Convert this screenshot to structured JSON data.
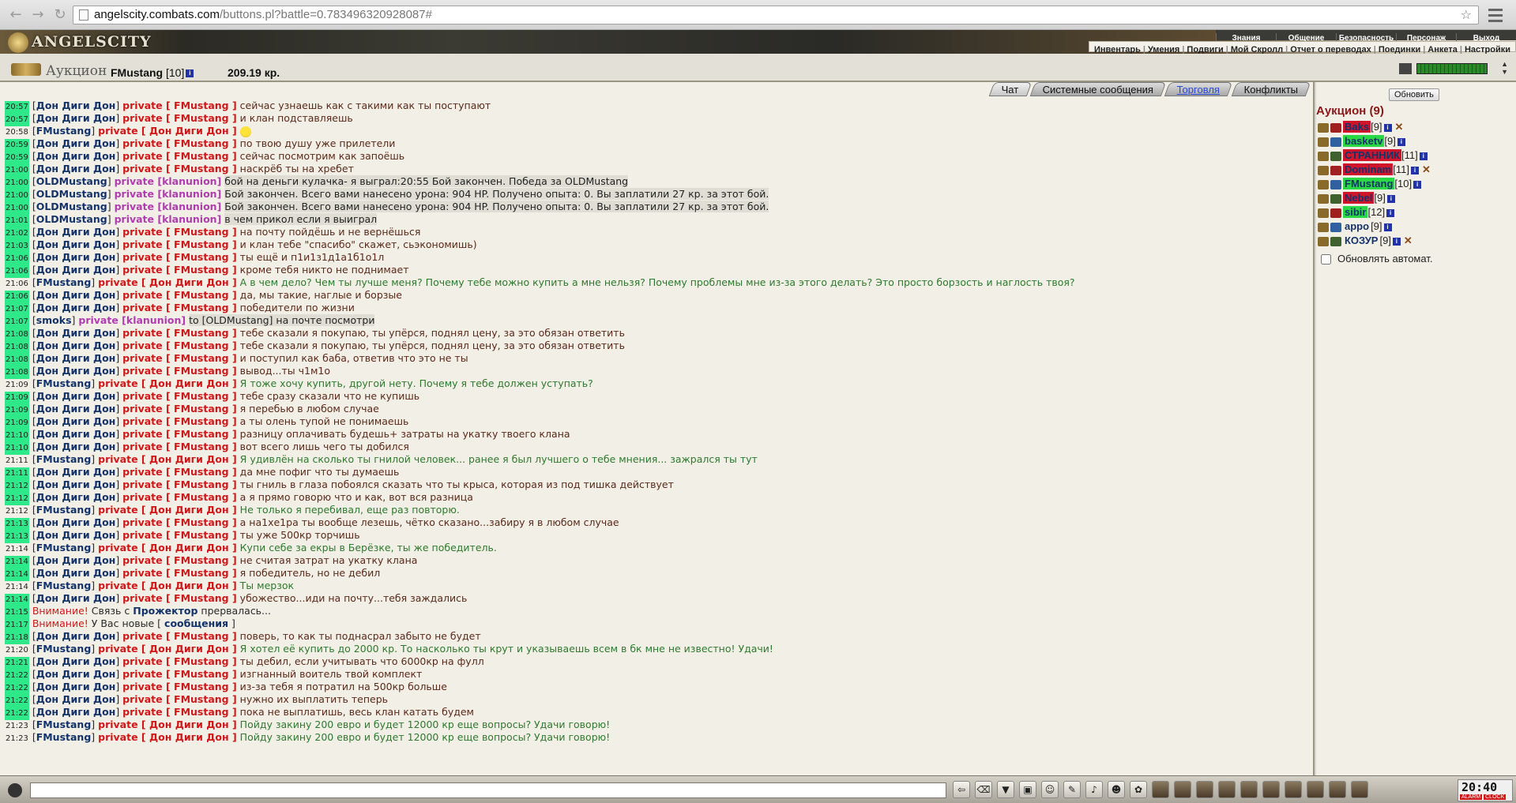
{
  "browser": {
    "url_host": "angelscity.combats.com",
    "url_rest": "/buttons.pl?battle=0.783496320928087#"
  },
  "game": {
    "logo": "ANGELSCITY",
    "top_menu": [
      "Знания",
      "Общение",
      "Безопасность",
      "Персонаж",
      "Выход"
    ],
    "sub_menu": [
      "Инвентарь",
      "Умения",
      "Подвиги",
      "Мой Скролл",
      "Отчет о переводах",
      "Поединки",
      "Анкета",
      "Настройки"
    ]
  },
  "location": {
    "name": "Аукцион",
    "user": "FMustang",
    "level": "[10]",
    "money": "209.19 кр."
  },
  "chat": {
    "tabs": [
      {
        "label": "Чат",
        "style": "active"
      },
      {
        "label": "Системные сообщения",
        "style": ""
      },
      {
        "label": "Торговля",
        "style": "link"
      },
      {
        "label": "Конфликты",
        "style": ""
      }
    ],
    "lines": [
      {
        "time": "20:57",
        "hl": true,
        "from": "Дон Диги Дон",
        "kind": "prv",
        "to": "FMustang",
        "mk": "in",
        "text": "сейчас узнаешь как с такими как ты поступают"
      },
      {
        "time": "20:57",
        "hl": true,
        "from": "Дон Диги Дон",
        "kind": "prv",
        "to": "FMustang",
        "mk": "in",
        "text": "и клан подставляешь"
      },
      {
        "time": "20:58",
        "hl": false,
        "from": "FMustang",
        "kind": "prv",
        "to": "Дон Диги Дон",
        "mk": "out",
        "text": "",
        "smile": true
      },
      {
        "time": "20:59",
        "hl": true,
        "from": "Дон Диги Дон",
        "kind": "prv",
        "to": "FMustang",
        "mk": "in",
        "text": "по твою душу уже прилетели"
      },
      {
        "time": "20:59",
        "hl": true,
        "from": "Дон Диги Дон",
        "kind": "prv",
        "to": "FMustang",
        "mk": "in",
        "text": "сейчас посмотрим как запоёшь"
      },
      {
        "time": "21:00",
        "hl": true,
        "from": "Дон Диги Дон",
        "kind": "prv",
        "to": "FMustang",
        "mk": "in",
        "text": "наскрёб ты на хребет"
      },
      {
        "time": "21:00",
        "hl": true,
        "from": "OLDMustang",
        "kind": "clan",
        "to": "klanunion",
        "mk": "sys",
        "text": "бой на деньги кулачка- я выграл:20:55 Бой закончен. Победа за OLDMustang"
      },
      {
        "time": "21:00",
        "hl": true,
        "from": "OLDMustang",
        "kind": "clan",
        "to": "klanunion",
        "mk": "sys",
        "text": "Бой закончен. Всего вами нанесено урона: 904 HP. Получено опыта: 0. Вы заплатили 27 кр. за этот бой."
      },
      {
        "time": "21:00",
        "hl": true,
        "from": "OLDMustang",
        "kind": "clan",
        "to": "klanunion",
        "mk": "sys",
        "text": "Бой закончен. Всего вами нанесено урона: 904 HP. Получено опыта: 0. Вы заплатили 27 кр. за этот бой."
      },
      {
        "time": "21:01",
        "hl": true,
        "from": "OLDMustang",
        "kind": "clan",
        "to": "klanunion",
        "mk": "sys",
        "text": "в чем прикол если я выиграл"
      },
      {
        "time": "21:02",
        "hl": true,
        "from": "Дон Диги Дон",
        "kind": "prv",
        "to": "FMustang",
        "mk": "in",
        "text": "на почту пойдёшь и не вернёшься"
      },
      {
        "time": "21:03",
        "hl": true,
        "from": "Дон Диги Дон",
        "kind": "prv",
        "to": "FMustang",
        "mk": "in",
        "text": "и клан тебе \"спасибо\" скажет, сьэкономишь)"
      },
      {
        "time": "21:06",
        "hl": true,
        "from": "Дон Диги Дон",
        "kind": "prv",
        "to": "FMustang",
        "mk": "in",
        "text": "ты ещё и п1и1з1д1а1б1о1л"
      },
      {
        "time": "21:06",
        "hl": true,
        "from": "Дон Диги Дон",
        "kind": "prv",
        "to": "FMustang",
        "mk": "in",
        "text": "кроме тебя никто не поднимает"
      },
      {
        "time": "21:06",
        "hl": false,
        "from": "FMustang",
        "kind": "prv",
        "to": "Дон Диги Дон",
        "mk": "out",
        "text": "А в чем дело? Чем ты лучше меня? Почему тебе можно купить а мне нельзя? Почему проблемы мне из-за этого делать? Это просто борзость и наглость твоя?"
      },
      {
        "time": "21:06",
        "hl": true,
        "from": "Дон Диги Дон",
        "kind": "prv",
        "to": "FMustang",
        "mk": "in",
        "text": "да, мы такие, наглые и борзые"
      },
      {
        "time": "21:07",
        "hl": true,
        "from": "Дон Диги Дон",
        "kind": "prv",
        "to": "FMustang",
        "mk": "in",
        "text": "победители по жизни"
      },
      {
        "time": "21:07",
        "hl": true,
        "from": "smoks",
        "kind": "clan",
        "to": "klanunion",
        "mk": "sys",
        "text": "to [OLDMustang] на почте посмотри"
      },
      {
        "time": "21:08",
        "hl": true,
        "from": "Дон Диги Дон",
        "kind": "prv",
        "to": "FMustang",
        "mk": "in",
        "text": "тебе сказали я покупаю, ты упёрся, поднял цену, за это обязан ответить"
      },
      {
        "time": "21:08",
        "hl": true,
        "from": "Дон Диги Дон",
        "kind": "prv",
        "to": "FMustang",
        "mk": "in",
        "text": "тебе сказали я покупаю, ты упёрся, поднял цену, за это обязан ответить"
      },
      {
        "time": "21:08",
        "hl": true,
        "from": "Дон Диги Дон",
        "kind": "prv",
        "to": "FMustang",
        "mk": "in",
        "text": "и поступил как баба, ответив что это не ты"
      },
      {
        "time": "21:08",
        "hl": true,
        "from": "Дон Диги Дон",
        "kind": "prv",
        "to": "FMustang",
        "mk": "in",
        "text": "вывод...ты ч1м1о"
      },
      {
        "time": "21:09",
        "hl": false,
        "from": "FMustang",
        "kind": "prv",
        "to": "Дон Диги Дон",
        "mk": "out",
        "text": "Я тоже хочу купить, другой нету. Почему я тебе должен уступать?"
      },
      {
        "time": "21:09",
        "hl": true,
        "from": "Дон Диги Дон",
        "kind": "prv",
        "to": "FMustang",
        "mk": "in",
        "text": "тебе сразу сказали что не купишь"
      },
      {
        "time": "21:09",
        "hl": true,
        "from": "Дон Диги Дон",
        "kind": "prv",
        "to": "FMustang",
        "mk": "in",
        "text": "я перебью в любом случае"
      },
      {
        "time": "21:09",
        "hl": true,
        "from": "Дон Диги Дон",
        "kind": "prv",
        "to": "FMustang",
        "mk": "in",
        "text": "а ты олень тупой не понимаешь"
      },
      {
        "time": "21:10",
        "hl": true,
        "from": "Дон Диги Дон",
        "kind": "prv",
        "to": "FMustang",
        "mk": "in",
        "text": "разницу оплачивать будешь+ затраты на укатку твоего клана"
      },
      {
        "time": "21:10",
        "hl": true,
        "from": "Дон Диги Дон",
        "kind": "prv",
        "to": "FMustang",
        "mk": "in",
        "text": "вот всего лишь чего ты добился"
      },
      {
        "time": "21:11",
        "hl": false,
        "from": "FMustang",
        "kind": "prv",
        "to": "Дон Диги Дон",
        "mk": "out",
        "text": "Я удивлён на сколько ты гнилой человек... ранее я был лучшего о тебе мнения... зажрался ты тут"
      },
      {
        "time": "21:11",
        "hl": true,
        "from": "Дон Диги Дон",
        "kind": "prv",
        "to": "FMustang",
        "mk": "in",
        "text": "да мне пофиг что ты думаешь"
      },
      {
        "time": "21:12",
        "hl": true,
        "from": "Дон Диги Дон",
        "kind": "prv",
        "to": "FMustang",
        "mk": "in",
        "text": "ты гниль в глаза побоялся сказать что ты крыса, которая из под тишка действует"
      },
      {
        "time": "21:12",
        "hl": true,
        "from": "Дон Диги Дон",
        "kind": "prv",
        "to": "FMustang",
        "mk": "in",
        "text": "а я прямо говорю что и как, вот вся разница"
      },
      {
        "time": "21:12",
        "hl": false,
        "from": "FMustang",
        "kind": "prv",
        "to": "Дон Диги Дон",
        "mk": "out",
        "text": "Не только я перебивал, еще раз повторю."
      },
      {
        "time": "21:13",
        "hl": true,
        "from": "Дон Диги Дон",
        "kind": "prv",
        "to": "FMustang",
        "mk": "in",
        "text": "а на1хе1ра ты вообще лезешь, чётко сказано...забиру я в любом случае"
      },
      {
        "time": "21:13",
        "hl": true,
        "from": "Дон Диги Дон",
        "kind": "prv",
        "to": "FMustang",
        "mk": "in",
        "text": "ты уже 500кр торчишь"
      },
      {
        "time": "21:14",
        "hl": false,
        "from": "FMustang",
        "kind": "prv",
        "to": "Дон Диги Дон",
        "mk": "out",
        "text": "Купи себе за екры в Берёзке, ты же победитель."
      },
      {
        "time": "21:14",
        "hl": true,
        "from": "Дон Диги Дон",
        "kind": "prv",
        "to": "FMustang",
        "mk": "in",
        "text": "не считая затрат на укатку клана"
      },
      {
        "time": "21:14",
        "hl": true,
        "from": "Дон Диги Дон",
        "kind": "prv",
        "to": "FMustang",
        "mk": "in",
        "text": "я победитель, но не дебил"
      },
      {
        "time": "21:14",
        "hl": false,
        "from": "FMustang",
        "kind": "prv",
        "to": "Дон Диги Дон",
        "mk": "out",
        "text": "Ты мерзок"
      },
      {
        "time": "21:14",
        "hl": true,
        "from": "Дон Диги Дон",
        "kind": "prv",
        "to": "FMustang",
        "mk": "in",
        "text": "убожество...иди на почту...тебя заждались"
      },
      {
        "time": "21:15",
        "hl": true,
        "kind": "warn",
        "warn": "Внимание!",
        "pre": "Связь с",
        "bold": "Прожектор",
        "post": "прервалась..."
      },
      {
        "time": "21:17",
        "hl": true,
        "kind": "warn",
        "warn": "Внимание!",
        "pre": "У Вас новые [",
        "bold": "сообщения",
        "post": "]"
      },
      {
        "time": "21:18",
        "hl": true,
        "from": "Дон Диги Дон",
        "kind": "prv",
        "to": "FMustang",
        "mk": "in",
        "text": "поверь, то как ты поднасрал забыто не будет"
      },
      {
        "time": "21:20",
        "hl": false,
        "from": "FMustang",
        "kind": "prv",
        "to": "Дон Диги Дон",
        "mk": "out",
        "text": "Я хотел её купить до 2000 кр. То насколько ты крут и указываешь всем в бк мне не известно! Удачи!"
      },
      {
        "time": "21:21",
        "hl": true,
        "from": "Дон Диги Дон",
        "kind": "prv",
        "to": "FMustang",
        "mk": "in",
        "text": "ты дебил, если учитывать что 6000кр на фулл"
      },
      {
        "time": "21:22",
        "hl": true,
        "from": "Дон Диги Дон",
        "kind": "prv",
        "to": "FMustang",
        "mk": "in",
        "text": "изгнанный воитель твой комплект"
      },
      {
        "time": "21:22",
        "hl": true,
        "from": "Дон Диги Дон",
        "kind": "prv",
        "to": "FMustang",
        "mk": "in",
        "text": "из-за тебя я потратил на 500кр больше"
      },
      {
        "time": "21:22",
        "hl": true,
        "from": "Дон Диги Дон",
        "kind": "prv",
        "to": "FMustang",
        "mk": "in",
        "text": "нужно их выплатить теперь"
      },
      {
        "time": "21:22",
        "hl": true,
        "from": "Дон Диги Дон",
        "kind": "prv",
        "to": "FMustang",
        "mk": "in",
        "text": "пока не выплатишь, весь клан катать будем"
      },
      {
        "time": "21:23",
        "hl": false,
        "from": "FMustang",
        "kind": "prv",
        "to": "Дон Диги Дон",
        "mk": "out",
        "text": "Пойду закину 200 евро и будет 12000 кр еще вопросы? Удачи говорю!"
      },
      {
        "time": "21:23",
        "hl": false,
        "from": "FMustang",
        "kind": "prv",
        "to": "Дон Диги Дон",
        "mk": "out",
        "text": "Пойду закину 200 евро и будет 12000 кр еще вопросы? Удачи говорю!"
      }
    ]
  },
  "room": {
    "refresh_label": "Обновить",
    "title": "Аукцион (9)",
    "users": [
      {
        "name": "Baks",
        "level": "[9]",
        "bg": "red",
        "x": true
      },
      {
        "name": "basketv",
        "level": "[9]",
        "bg": "green",
        "x": false
      },
      {
        "name": "СТРАННИК",
        "level": "[11]",
        "bg": "red",
        "x": false
      },
      {
        "name": "Dominam",
        "level": "[11]",
        "bg": "red",
        "x": true
      },
      {
        "name": "FMustang",
        "level": "[10]",
        "bg": "green",
        "x": false
      },
      {
        "name": "Nebel",
        "level": "[9]",
        "bg": "red",
        "x": false
      },
      {
        "name": "sibir",
        "level": "[12]",
        "bg": "green",
        "x": false
      },
      {
        "name": "appo",
        "level": "[9]",
        "bg": "",
        "x": false
      },
      {
        "name": "КОЗУР",
        "level": "[9]",
        "bg": "",
        "x": true
      }
    ],
    "auto_refresh_label": "Обновлять автомат."
  },
  "clock": {
    "time": "20:40",
    "labels": [
      "ALARM",
      "CLOCK"
    ]
  },
  "colors": {
    "time_highlight": "#2ee88a",
    "private": "#d01818",
    "clan": "#b03cb0",
    "incoming": "#5a2a1a",
    "outgoing": "#2e7a2e"
  }
}
